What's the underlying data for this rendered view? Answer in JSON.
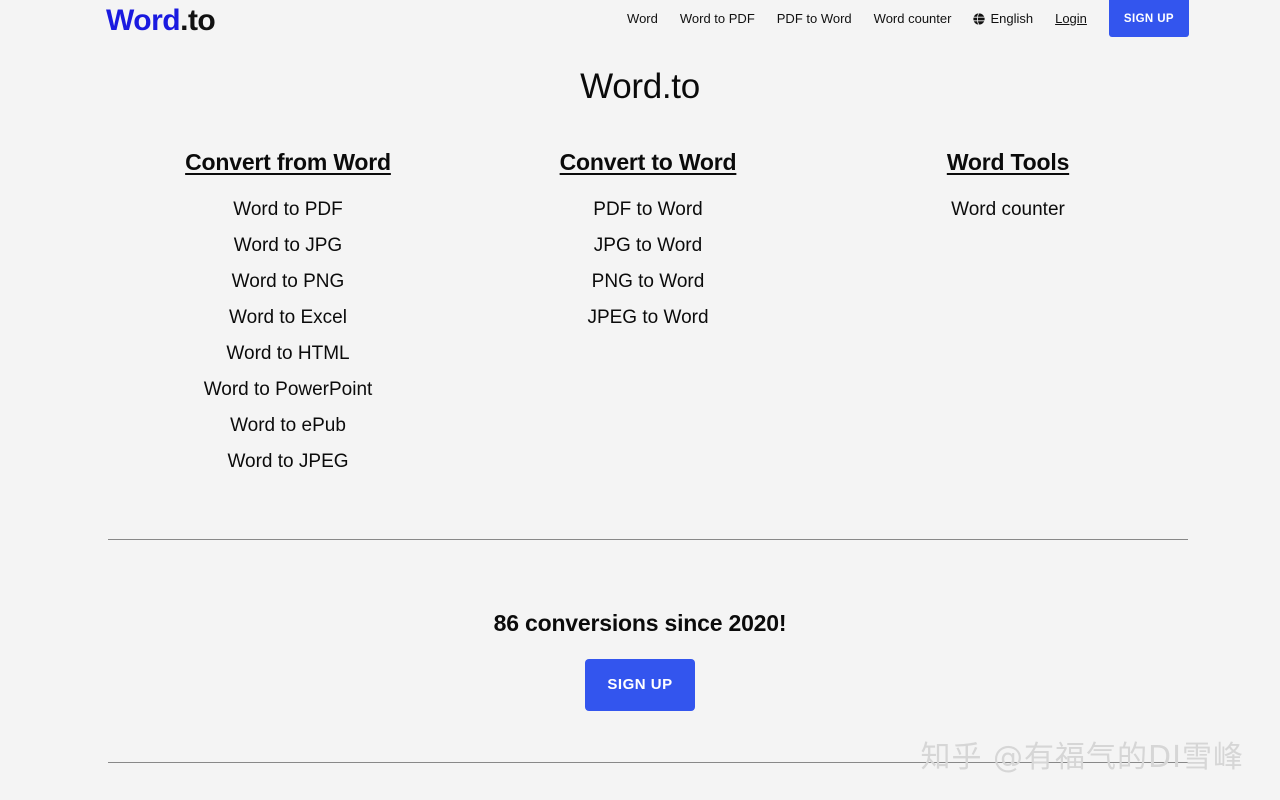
{
  "header": {
    "logo": {
      "brand": "Word",
      "tld": ".to"
    },
    "nav_links": [
      {
        "label": "Word"
      },
      {
        "label": "Word to PDF"
      },
      {
        "label": "PDF to Word"
      },
      {
        "label": "Word counter"
      }
    ],
    "language": {
      "icon": "globe-icon",
      "label": "English"
    },
    "login_label": "Login",
    "signup_label": "SIGN UP"
  },
  "main": {
    "title": "Word.to",
    "columns": [
      {
        "title": "Convert from Word",
        "items": [
          "Word to PDF",
          "Word to JPG",
          "Word to PNG",
          "Word to Excel",
          "Word to HTML",
          "Word to PowerPoint",
          "Word to ePub",
          "Word to JPEG"
        ]
      },
      {
        "title": "Convert to Word",
        "items": [
          "PDF to Word",
          "JPG to Word",
          "PNG to Word",
          "JPEG to Word"
        ]
      },
      {
        "title": "Word Tools",
        "items": [
          "Word counter"
        ]
      }
    ]
  },
  "cta": {
    "text": "86 conversions since 2020!",
    "signup_label": "SIGN UP"
  },
  "watermark": {
    "text": "知乎 @有福气的DI雪峰"
  },
  "colors": {
    "background": "#f4f4f4",
    "logo_blue": "#1a1ae0",
    "button_blue": "#3355ee",
    "text": "#0b0b0b",
    "divider": "#888888",
    "watermark": "#d6d6d6"
  }
}
